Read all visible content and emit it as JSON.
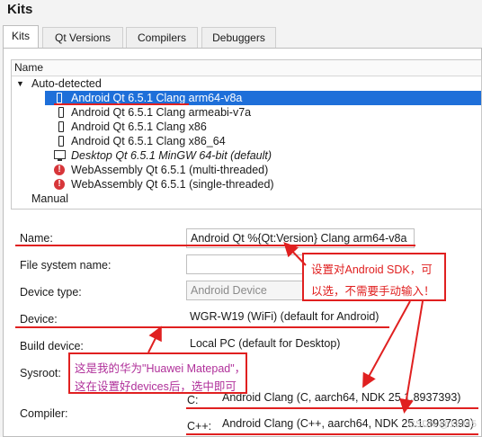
{
  "window": {
    "title": "Kits"
  },
  "tabs": [
    "Kits",
    "Qt Versions",
    "Compilers",
    "Debuggers"
  ],
  "tree": {
    "header": "Name",
    "group_auto": "Auto-detected",
    "group_manual": "Manual",
    "items": [
      {
        "label": "Android Qt 6.5.1 Clang arm64-v8a",
        "icon": "android-device-icon",
        "selected": true
      },
      {
        "label": "Android Qt 6.5.1 Clang armeabi-v7a",
        "icon": "android-device-icon"
      },
      {
        "label": "Android Qt 6.5.1 Clang x86",
        "icon": "android-device-icon"
      },
      {
        "label": "Android Qt 6.5.1 Clang x86_64",
        "icon": "android-device-icon"
      },
      {
        "label": "Desktop Qt 6.5.1 MinGW 64-bit (default)",
        "icon": "desktop-monitor-icon"
      },
      {
        "label": "WebAssembly Qt 6.5.1 (multi-threaded)",
        "icon": "error-icon"
      },
      {
        "label": "WebAssembly Qt 6.5.1 (single-threaded)",
        "icon": "error-icon"
      }
    ]
  },
  "form": {
    "name_label": "Name:",
    "name_value": "Android Qt %{Qt:Version} Clang arm64-v8a",
    "fs_label": "File system name:",
    "fs_value": "",
    "device_type_label": "Device type:",
    "device_type_value": "Android Device",
    "device_label": "Device:",
    "device_value": "WGR-W19 (WiFi) (default for Android)",
    "build_device_label": "Build device:",
    "build_device_value": "Local PC (default for Desktop)",
    "sysroot_label": "Sysroot:",
    "compiler_label": "Compiler:",
    "compiler_c_label": "C:",
    "compiler_c_value": "Android Clang (C, aarch64, NDK 25.1.8937393)",
    "compiler_cpp_label": "C++:",
    "compiler_cpp_value": "Android Clang (C++, aarch64, NDK 25.1.8937393)"
  },
  "annotations": {
    "sdk_line1": "设置对Android SDK，可",
    "sdk_line2": "以选，不需要手动输入！",
    "device_line1": "这是我的华为\"Huawei Matepad\"，",
    "device_line2": "这在设置好devices后，选中即可"
  },
  "watermark": "CSDN @12345",
  "colors": {
    "selection": "#1e6fd9",
    "annotation_red": "#e02020",
    "annotation_pink": "#b0309a"
  }
}
